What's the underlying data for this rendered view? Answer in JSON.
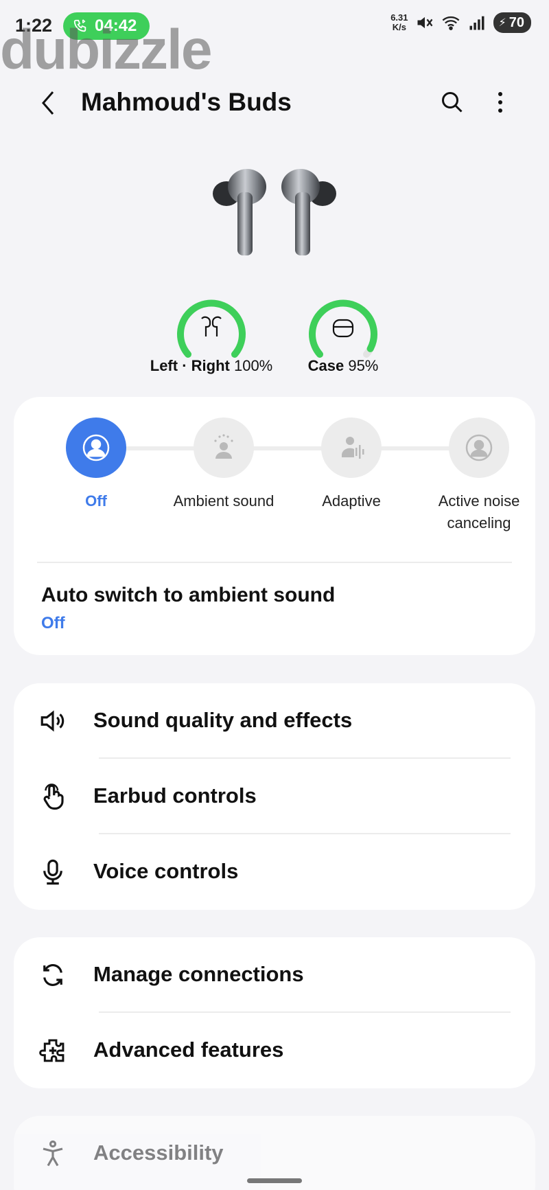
{
  "status_bar": {
    "time": "1:22",
    "call_timer": "04:42",
    "speed_value": "6.31",
    "speed_unit": "K/s",
    "battery": "70",
    "icons": [
      "phone-bluetooth-icon",
      "mute-icon",
      "wifi-icon",
      "signal-icon",
      "battery-icon"
    ]
  },
  "watermark": "dubizzle",
  "header": {
    "title": "Mahmoud's Buds",
    "icons": [
      "back-arrow-icon",
      "search-icon",
      "more-vert-icon"
    ]
  },
  "device_image": "earbuds-image",
  "battery": {
    "buds": {
      "label": "Left · Right",
      "percent": "100%",
      "level": 1.0
    },
    "case": {
      "label": "Case",
      "percent": "95%",
      "level": 0.95
    },
    "ring_color": "#3ecf5a"
  },
  "noise_controls": {
    "options": [
      {
        "label": "Off",
        "active": true
      },
      {
        "label": "Ambient sound",
        "active": false
      },
      {
        "label": "Adaptive",
        "active": false
      },
      {
        "label": "Active noise canceling",
        "active": false
      }
    ],
    "accent_color": "#3f7bea"
  },
  "auto_switch": {
    "title": "Auto switch to ambient sound",
    "value": "Off"
  },
  "sound_menu": [
    {
      "label": "Sound quality and effects",
      "icon": "speaker-icon"
    },
    {
      "label": "Earbud controls",
      "icon": "touch-icon"
    },
    {
      "label": "Voice controls",
      "icon": "microphone-icon"
    }
  ],
  "connection_menu": [
    {
      "label": "Manage connections",
      "icon": "sync-icon"
    },
    {
      "label": "Advanced features",
      "icon": "puzzle-icon"
    }
  ],
  "accessibility_menu": [
    {
      "label": "Accessibility",
      "icon": "accessibility-icon"
    }
  ]
}
